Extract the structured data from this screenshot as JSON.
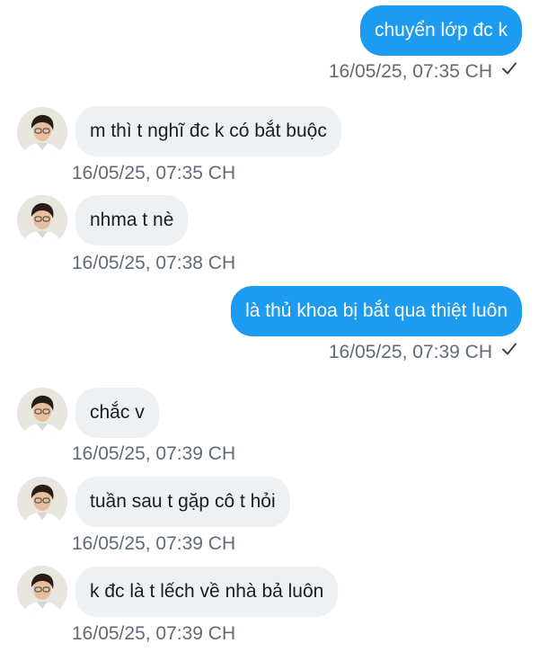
{
  "messages": [
    {
      "direction": "outgoing",
      "text": "chuyển lớp đc k",
      "time": "16/05/25, 07:35 CH",
      "read_icon": "checkmark-icon"
    },
    {
      "direction": "incoming",
      "text": "m thì t nghĩ đc k có bắt buộc",
      "time": "16/05/25, 07:35 CH"
    },
    {
      "direction": "incoming",
      "text": "nhma t nè",
      "time": "16/05/25, 07:38 CH"
    },
    {
      "direction": "outgoing",
      "text": "là thủ khoa bị bắt qua thiệt luôn",
      "time": "16/05/25, 07:39 CH",
      "read_icon": "checkmark-icon"
    },
    {
      "direction": "incoming",
      "text": "chắc v",
      "time": "16/05/25, 07:39 CH"
    },
    {
      "direction": "incoming",
      "text": "tuần sau t gặp cô t hỏi",
      "time": "16/05/25, 07:39 CH"
    },
    {
      "direction": "incoming",
      "text": "k đc là t lếch về nhà bả luôn",
      "time": "16/05/25, 07:39 CH"
    }
  ],
  "colors": {
    "outgoing_bubble": "#1d9bf0",
    "incoming_bubble": "#eef1f4",
    "timestamp": "#5f6b76"
  }
}
